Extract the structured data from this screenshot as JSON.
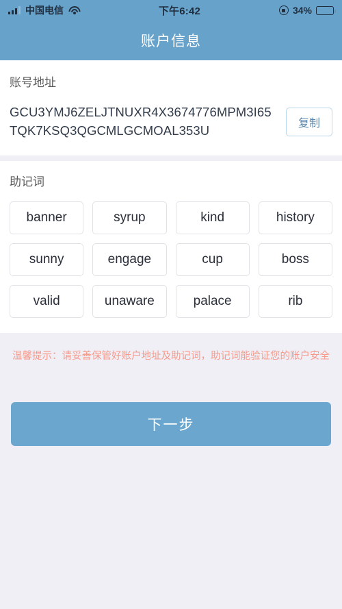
{
  "statusbar": {
    "signal_icon": "signal-bars-icon",
    "carrier": "中国电信",
    "wifi_icon": "wifi-icon",
    "time": "下午6:42",
    "orientation_lock_icon": "rotation-lock-icon",
    "battery_percent": "34%",
    "battery_level": 34,
    "battery_icon": "battery-icon"
  },
  "header": {
    "title": "账户信息"
  },
  "address_section": {
    "label": "账号地址",
    "address": "GCU3YMJ6ZELJTNUXR4X3674776MPM3I65TQK7KSQ3QGCMLGCMOAL353U",
    "copy_label": "复制"
  },
  "mnemonic_section": {
    "label": "助记词",
    "words": [
      "banner",
      "syrup",
      "kind",
      "history",
      "sunny",
      "engage",
      "cup",
      "boss",
      "valid",
      "unaware",
      "palace",
      "rib"
    ]
  },
  "warning": {
    "text": "温馨提示：请妥善保管好账户地址及助记词，助记词能验证您的账户安全"
  },
  "footer": {
    "next_label": "下一步"
  },
  "colors": {
    "brand_blue": "#67a2cb",
    "button_blue": "#6aa6ce",
    "warning_salmon": "#f79a8c",
    "page_bg": "#f0eff5",
    "card_bg": "#ffffff",
    "chip_border": "#e2e2e6"
  }
}
